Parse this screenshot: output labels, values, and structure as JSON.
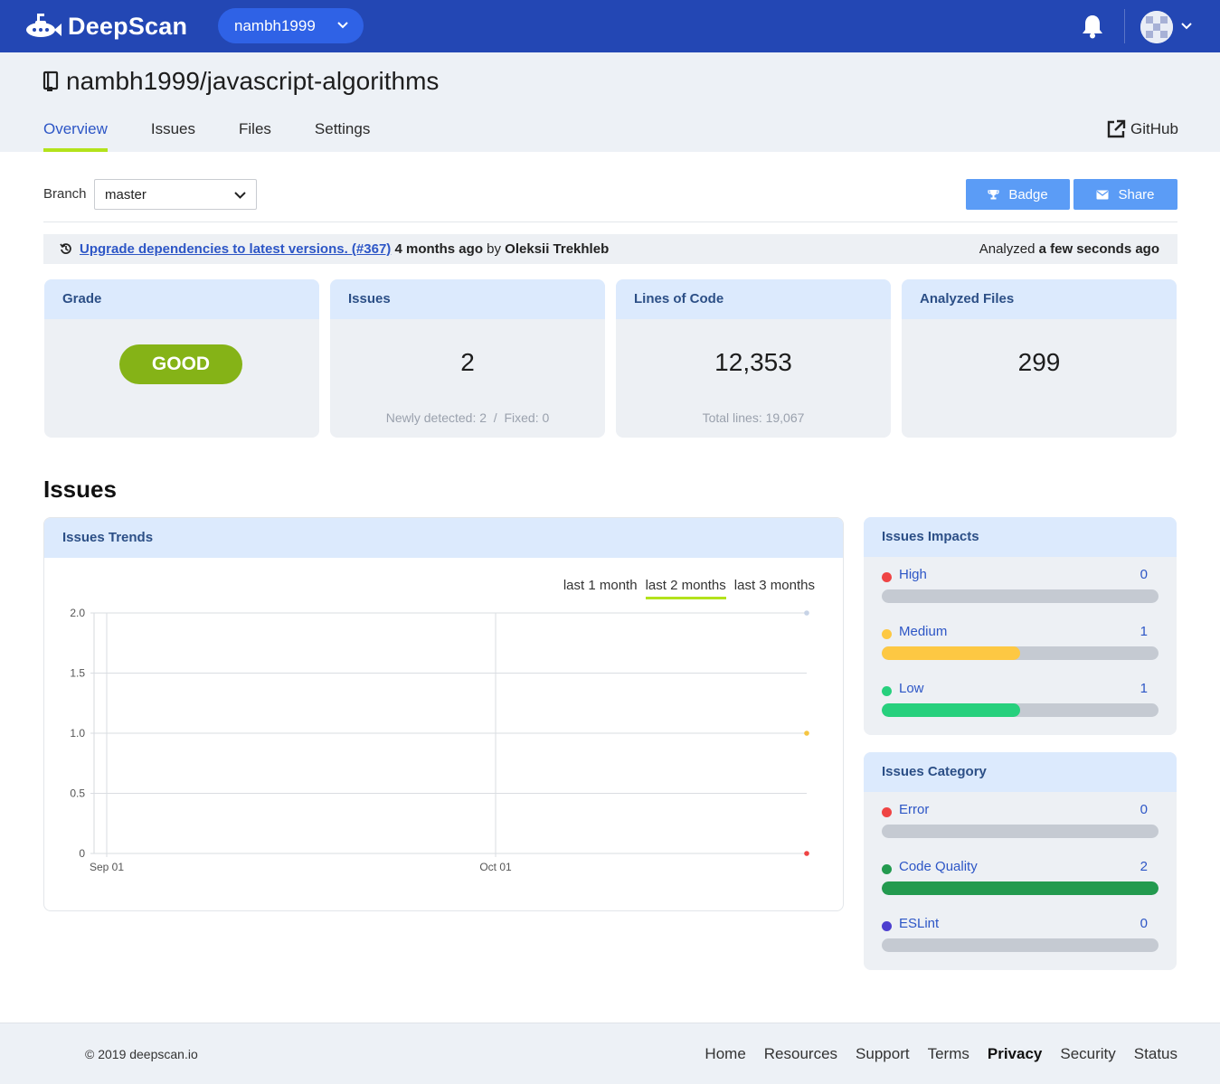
{
  "nav": {
    "brand": "DeepScan",
    "org": "nambh1999"
  },
  "repo": {
    "title": "nambh1999/javascript-algorithms",
    "tabs": [
      "Overview",
      "Issues",
      "Files",
      "Settings"
    ],
    "active_tab": "Overview",
    "github_label": "GitHub"
  },
  "branch": {
    "label": "Branch",
    "value": "master"
  },
  "actions": {
    "badge": "Badge",
    "share": "Share"
  },
  "commit": {
    "message": "Upgrade dependencies to latest versions. (#367)",
    "time": "4 months ago",
    "by": "by",
    "author": "Oleksii Trekhleb",
    "analyzed_prefix": "Analyzed",
    "analyzed_time": "a few seconds ago"
  },
  "cards": {
    "grade": {
      "title": "Grade",
      "value": "GOOD"
    },
    "issues": {
      "title": "Issues",
      "value": "2",
      "sub": "Newly detected: 2  /  Fixed: 0"
    },
    "loc": {
      "title": "Lines of Code",
      "value": "12,353",
      "sub": "Total lines: 19,067"
    },
    "files": {
      "title": "Analyzed Files",
      "value": "299"
    }
  },
  "issues_section": {
    "title": "Issues",
    "trends_title": "Issues Trends",
    "ranges": [
      "last 1 month",
      "last 2 months",
      "last 3 months"
    ],
    "active_range": "last 2 months"
  },
  "chart_data": {
    "type": "line",
    "title": "Issues Trends",
    "xlabel": "",
    "ylabel": "",
    "x_tick_labels": [
      "Sep 01",
      "Oct 01"
    ],
    "y_tick_labels": [
      "2.0",
      "1.5",
      "1.0",
      "0.5",
      "0"
    ],
    "ylim": [
      0,
      2
    ],
    "grid": true,
    "points": [
      {
        "color": "#c7d3e6",
        "y": 2
      },
      {
        "color": "#f5c542",
        "y": 1
      },
      {
        "color": "#ef4444",
        "y": 0
      }
    ]
  },
  "impacts": {
    "title": "Issues Impacts",
    "items": [
      {
        "label": "High",
        "count": "0",
        "color": "#ef4444",
        "fraction": 0
      },
      {
        "label": "Medium",
        "count": "1",
        "color": "#fdc843",
        "fraction": 0.5
      },
      {
        "label": "Low",
        "count": "1",
        "color": "#27d07d",
        "fraction": 0.5
      }
    ]
  },
  "category": {
    "title": "Issues Category",
    "items": [
      {
        "label": "Error",
        "count": "0",
        "color": "#ef4444",
        "fraction": 0
      },
      {
        "label": "Code Quality",
        "count": "2",
        "color": "#239a4f",
        "fraction": 1
      },
      {
        "label": "ESLint",
        "count": "0",
        "color": "#4d3fcf",
        "fraction": 0
      }
    ]
  },
  "footer": {
    "copyright": "© 2019 deepscan.io",
    "links": [
      "Home",
      "Resources",
      "Support",
      "Terms",
      "Privacy",
      "Security",
      "Status"
    ]
  }
}
